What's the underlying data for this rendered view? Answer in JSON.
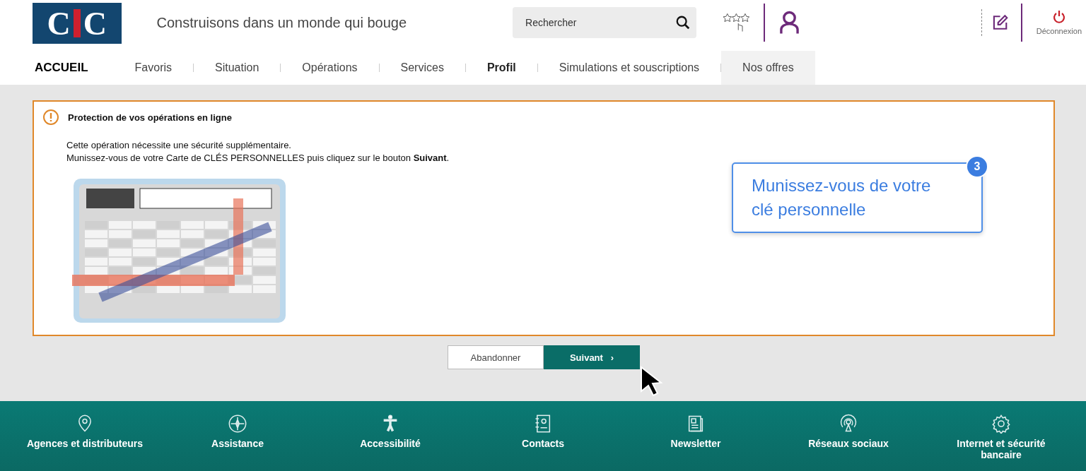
{
  "logo": [
    "C",
    "C"
  ],
  "tagline": "Construisons dans un monde qui bouge",
  "search": {
    "placeholder": "Rechercher"
  },
  "logout": {
    "label": "Déconnexion"
  },
  "nav": {
    "home": "ACCUEIL",
    "items": [
      {
        "label": "Favoris",
        "selected": false,
        "hovered": false
      },
      {
        "label": "Situation",
        "selected": false,
        "hovered": false
      },
      {
        "label": "Opérations",
        "selected": false,
        "hovered": false
      },
      {
        "label": "Services",
        "selected": false,
        "hovered": false
      },
      {
        "label": "Profil",
        "selected": true,
        "hovered": false
      },
      {
        "label": "Simulations et souscriptions",
        "selected": false,
        "hovered": false
      },
      {
        "label": "Nos offres",
        "selected": false,
        "hovered": true
      }
    ]
  },
  "alert": {
    "title": "Protection de vos opérations en ligne",
    "lines": [
      "Cette opération nécessite une sécurité supplémentaire.",
      "Munissez-vous de votre Carte de CLÉS PERSONNELLES puis cliquez sur le bouton **Suivant**."
    ]
  },
  "callout": {
    "badge": "3",
    "text": "Munissez-vous de votre clé personnelle"
  },
  "buttons": [
    {
      "label": "Abandonner",
      "kind": "secondary"
    },
    {
      "label": "Suivant",
      "kind": "primary",
      "chevron": "›"
    }
  ],
  "footer": [
    {
      "label": "Agences et distributeurs"
    },
    {
      "label": "Assistance"
    },
    {
      "label": "Accessibilité"
    },
    {
      "label": "Contacts"
    },
    {
      "label": "Newsletter"
    },
    {
      "label": "Réseaux sociaux"
    },
    {
      "label": "Internet et sécurité bancaire"
    }
  ]
}
